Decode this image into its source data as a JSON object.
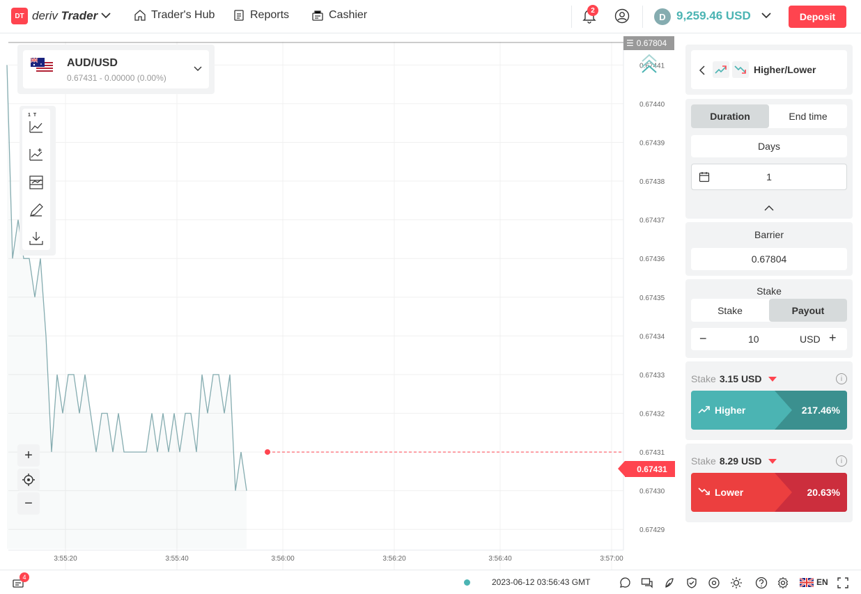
{
  "header": {
    "logo_badge": "DT",
    "logo_brand": "deriv",
    "logo_product": "Trader",
    "nav": [
      {
        "label": "Trader's Hub",
        "icon": "home-icon"
      },
      {
        "label": "Reports",
        "icon": "reports-icon"
      },
      {
        "label": "Cashier",
        "icon": "cashier-icon"
      }
    ],
    "notifications_count": "2",
    "balance_symbol": "D",
    "balance": "9,259.46 USD",
    "deposit_label": "Deposit"
  },
  "chart": {
    "asset_name": "AUD/USD",
    "asset_price": "0.67431 - 0.00000 (0.00%)",
    "tools_label": "1 T",
    "barrier_price": "0.67804",
    "current_price": "0.67431",
    "colors": {
      "line": "#85acb0",
      "current": "#ff444f",
      "barrier": "#999999"
    }
  },
  "chart_data": {
    "type": "line",
    "xlabel": "",
    "ylabel": "",
    "x_ticks": [
      "3:55:20",
      "3:55:40",
      "3:56:00",
      "3:56:20",
      "3:56:40",
      "3:57:00"
    ],
    "y_ticks": [
      "0.67441",
      "0.67440",
      "0.67439",
      "0.67438",
      "0.67437",
      "0.67436",
      "0.67435",
      "0.67434",
      "0.67433",
      "0.67432",
      "0.67431",
      "0.67430",
      "0.67429"
    ],
    "ylim": [
      0.674285,
      0.674416
    ],
    "grid": true,
    "series": [
      {
        "x": [
          0,
          2,
          4,
          6,
          8,
          10,
          12,
          14,
          16,
          18,
          20,
          22,
          24,
          26,
          28,
          30,
          32,
          34,
          36,
          38,
          40,
          42,
          44,
          46,
          48,
          50,
          52,
          54,
          56,
          58,
          60,
          62,
          64,
          66,
          68,
          70,
          72,
          74,
          76,
          78,
          80,
          82,
          84,
          86
        ],
        "y": [
          0.67441,
          0.67436,
          0.67437,
          0.67436,
          0.67436,
          0.67435,
          0.67436,
          0.67434,
          0.67431,
          0.67433,
          0.67432,
          0.67433,
          0.67433,
          0.67432,
          0.67433,
          0.67432,
          0.67431,
          0.67432,
          0.67432,
          0.67431,
          0.67432,
          0.67431,
          0.67431,
          0.67431,
          0.67431,
          0.67431,
          0.67432,
          0.67431,
          0.67432,
          0.67431,
          0.67432,
          0.67431,
          0.67432,
          0.67432,
          0.67431,
          0.67433,
          0.67432,
          0.67433,
          0.67433,
          0.67432,
          0.67433,
          0.6743,
          0.67431,
          0.6743
        ]
      }
    ]
  },
  "panel": {
    "contract_type": "Higher/Lower",
    "duration_tabs": [
      "Duration",
      "End time"
    ],
    "duration_unit": "Days",
    "duration_value": "1",
    "barrier_title": "Barrier",
    "barrier_value": "0.67804",
    "stake_title": "Stake",
    "stake_tabs": [
      "Stake",
      "Payout"
    ],
    "amount": "10",
    "currency": "USD",
    "higher": {
      "stake_label": "Stake",
      "stake_value": "3.15 USD",
      "label": "Higher",
      "percent": "217.46%",
      "color": "#4bb4b3",
      "dark": "#3b908f"
    },
    "lower": {
      "stake_label": "Stake",
      "stake_value": "8.29 USD",
      "label": "Lower",
      "percent": "20.63%",
      "color": "#ec3f3f",
      "dark": "#cc2e3d"
    }
  },
  "footer": {
    "positions_count": "4",
    "server_time": "2023-06-12 03:56:43 GMT",
    "language": "EN"
  }
}
